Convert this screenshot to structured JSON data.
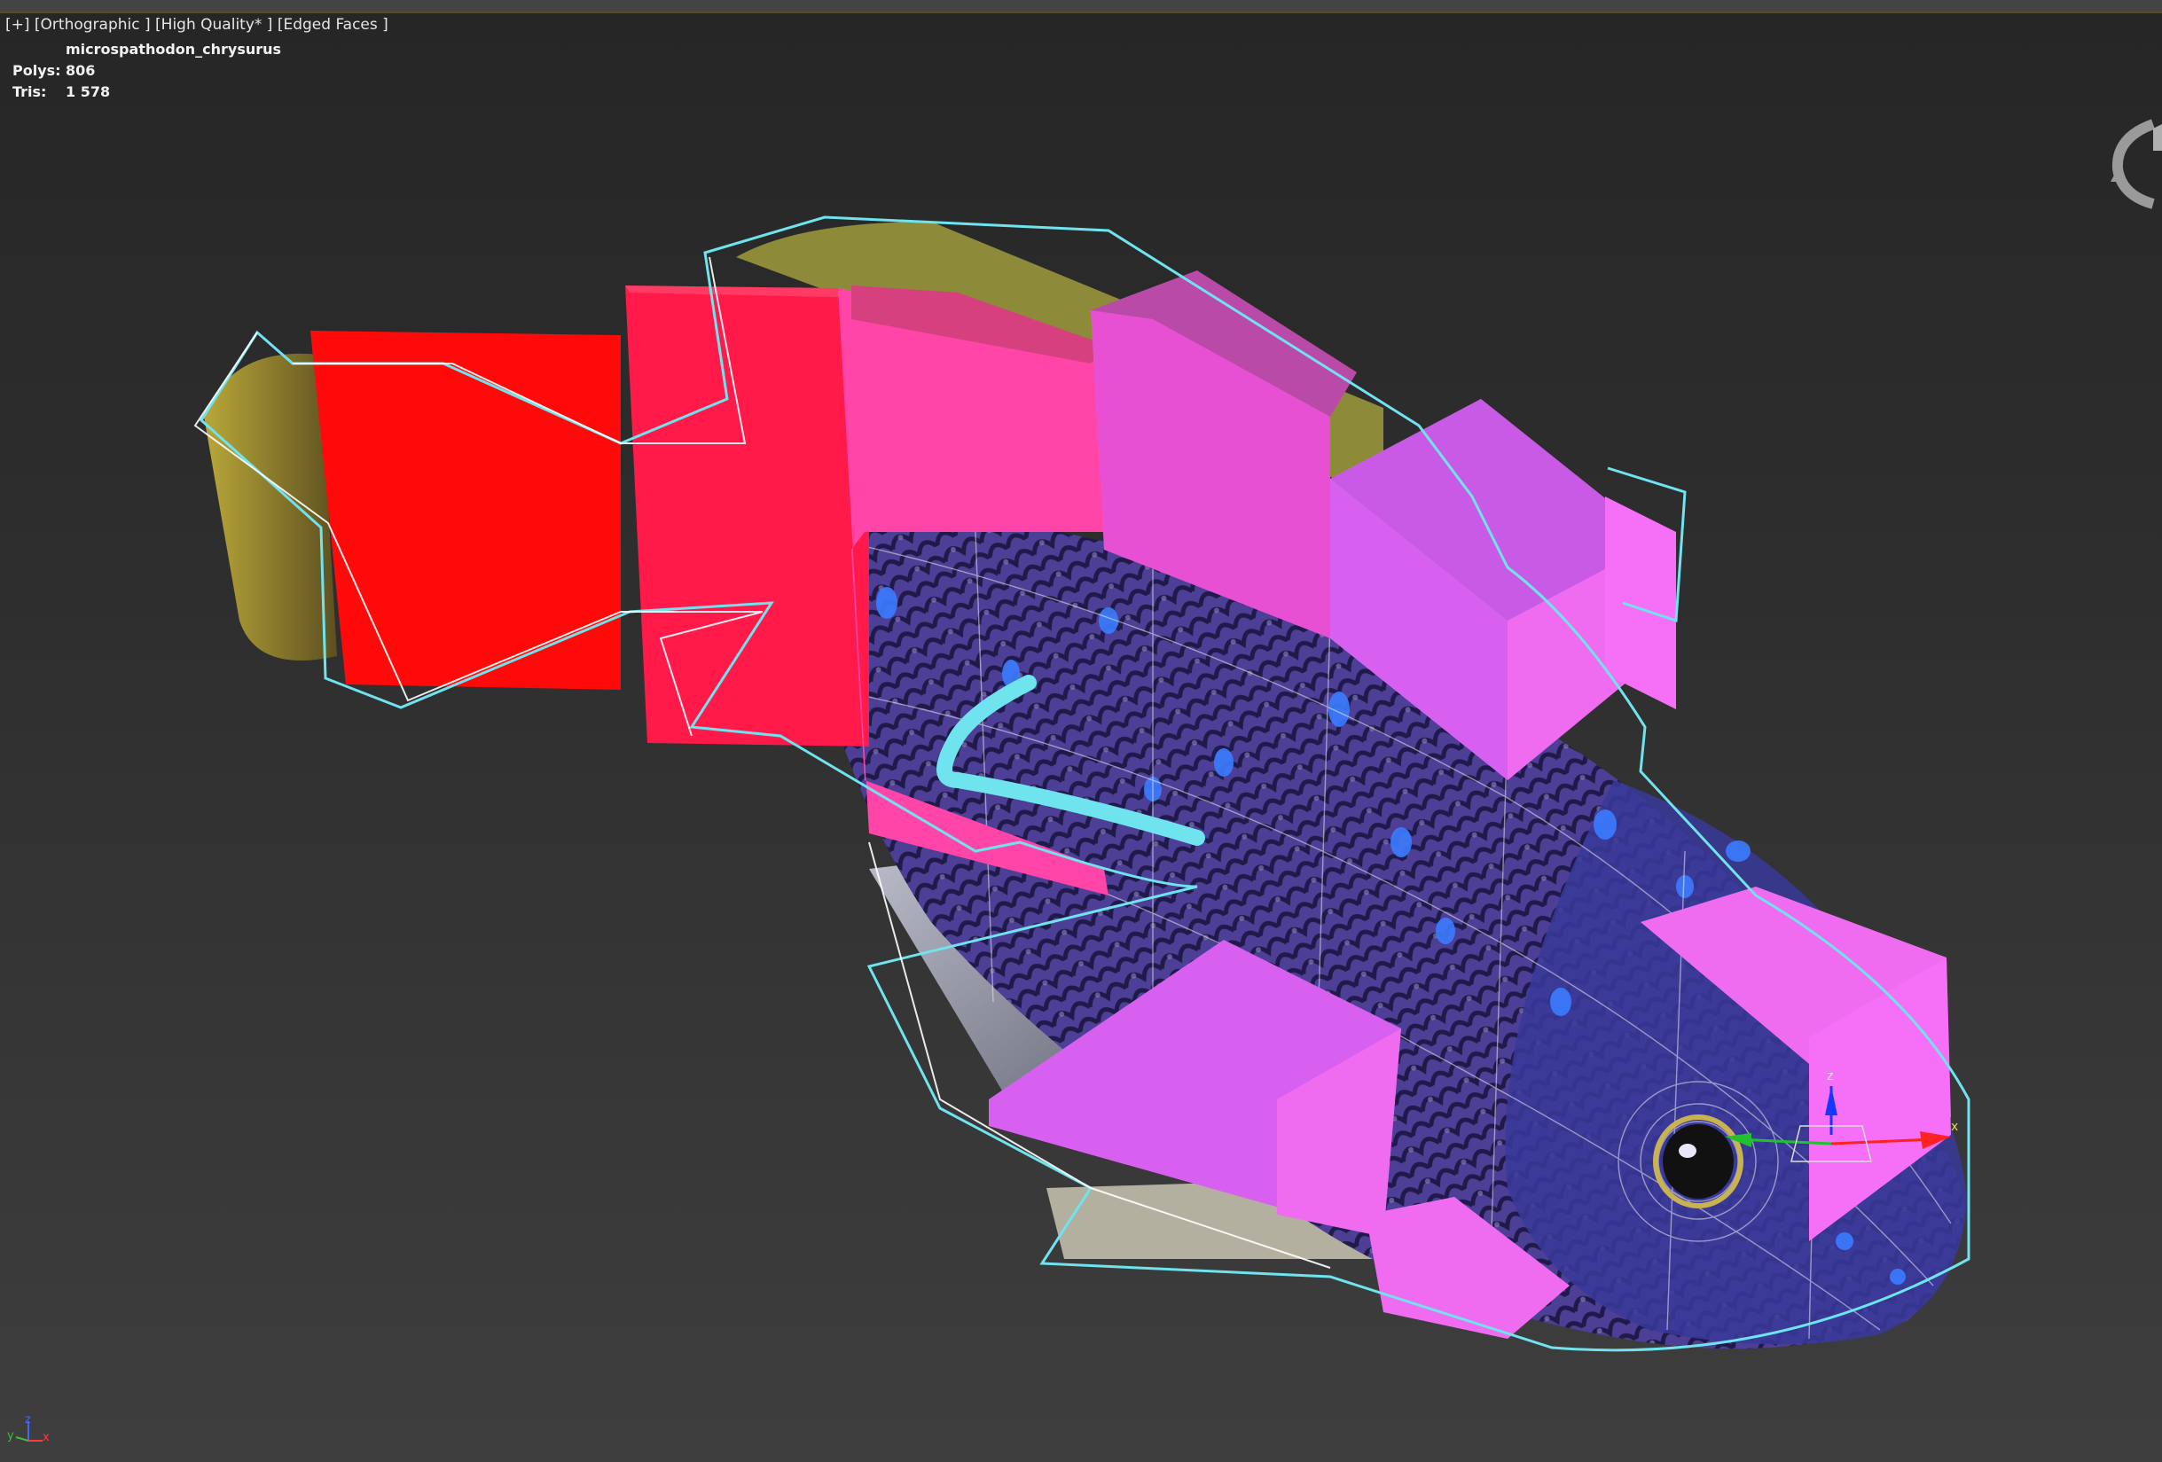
{
  "viewport": {
    "label_parts": [
      "[+]",
      "[Orthographic ]",
      "[High Quality* ]",
      "[Edged Faces ]"
    ]
  },
  "stats": {
    "object_name": "microspathodon_chrysurus",
    "polys_label": "Polys:",
    "polys_value": "806",
    "tris_label": "Tris:",
    "tris_value": "1 578"
  },
  "gizmo": {
    "z_label": "z",
    "x_label": "x"
  },
  "axis_tripod": {
    "y_label": "y",
    "z_label": "z",
    "x_label": "x"
  },
  "colors": {
    "selection_outline": "#6fe3ee",
    "box_red": "#ff0a0a",
    "box_crimson": "#ff1a4a",
    "box_pink": "#ff45a8",
    "box_magenta": "#e84fd8",
    "box_violet": "#d860f0",
    "box_light_violet": "#ef6cf0",
    "fish_body": "#4a3f9a",
    "fish_spots": "#3b7cff",
    "gizmo_z": "#1537ff",
    "gizmo_x": "#ff2222",
    "gizmo_y": "#20c030"
  },
  "icons": [
    "viewcube-icon",
    "axis-tripod-icon",
    "transform-gizmo-icon"
  ]
}
